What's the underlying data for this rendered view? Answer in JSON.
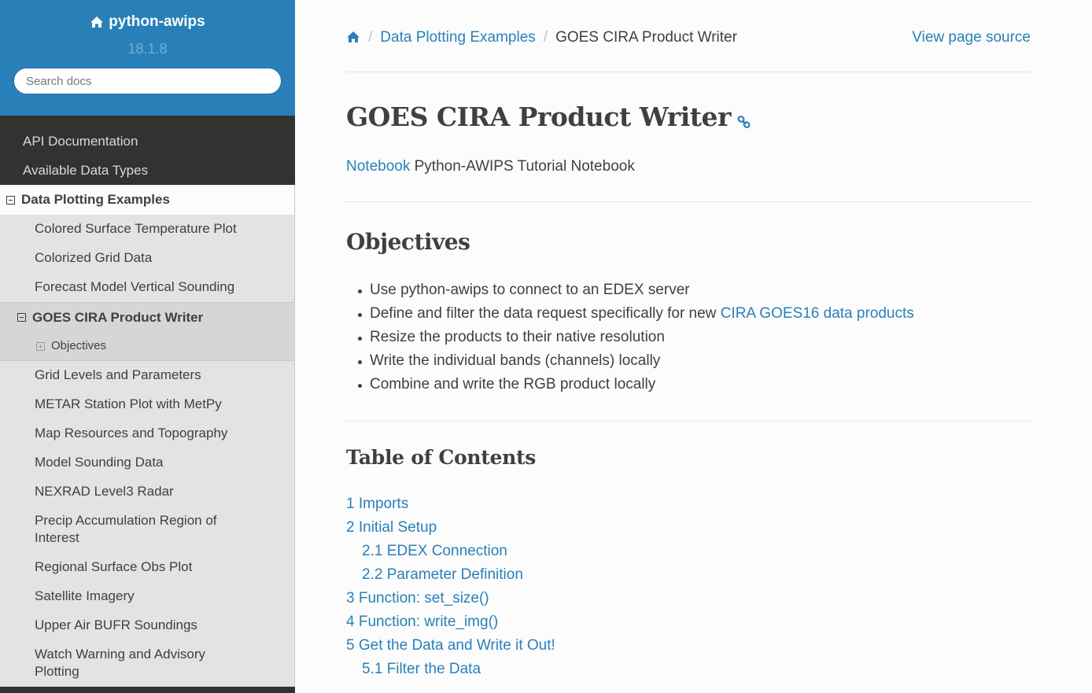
{
  "sidebar": {
    "project_name": "python-awips",
    "version": "18.1.8",
    "search_placeholder": "Search docs",
    "top_items": [
      {
        "label": "API Documentation"
      },
      {
        "label": "Available Data Types"
      }
    ],
    "current_section": "Data Plotting Examples",
    "sub_items_before": [
      {
        "label": "Colored Surface Temperature Plot"
      },
      {
        "label": "Colorized Grid Data"
      },
      {
        "label": "Forecast Model Vertical Sounding"
      }
    ],
    "current_page": "GOES CIRA Product Writer",
    "current_page_child": "Objectives",
    "sub_items_after": [
      {
        "label": "Grid Levels and Parameters"
      },
      {
        "label": "METAR Station Plot with MetPy"
      },
      {
        "label": "Map Resources and Topography"
      },
      {
        "label": "Model Sounding Data"
      },
      {
        "label": "NEXRAD Level3 Radar"
      },
      {
        "label": "Precip Accumulation Region of Interest"
      },
      {
        "label": "Regional Surface Obs Plot"
      },
      {
        "label": "Satellite Imagery"
      },
      {
        "label": "Upper Air BUFR Soundings"
      },
      {
        "label": "Watch Warning and Advisory Plotting"
      }
    ],
    "colors": {
      "header": "#2980b9",
      "dark": "#343131",
      "submenu": "#e3e3e3"
    }
  },
  "breadcrumbs": {
    "parent": "Data Plotting Examples",
    "current": "GOES CIRA Product Writer",
    "view_source": "View page source"
  },
  "content": {
    "title": "GOES CIRA Product Writer",
    "notebook_link": "Notebook",
    "notebook_text": " Python-AWIPS Tutorial Notebook",
    "objectives_title": "Objectives",
    "objectives": [
      {
        "text": "Use python-awips to connect to an EDEX server",
        "link": ""
      },
      {
        "text": "Define and filter the data request specifically for new ",
        "link": "CIRA GOES16 data products"
      },
      {
        "text": "Resize the products to their native resolution",
        "link": ""
      },
      {
        "text": "Write the individual bands (channels) locally",
        "link": ""
      },
      {
        "text": "Combine and write the RGB product locally",
        "link": ""
      }
    ],
    "toc_title": "Table of Contents",
    "toc": [
      {
        "label": "1 Imports",
        "level": 1
      },
      {
        "label": "2 Initial Setup",
        "level": 1
      },
      {
        "label": "2.1 EDEX Connection",
        "level": 2
      },
      {
        "label": "2.2 Parameter Definition",
        "level": 2
      },
      {
        "label": "3 Function: set_size()",
        "level": 1
      },
      {
        "label": "4 Function: write_img()",
        "level": 1
      },
      {
        "label": "5 Get the Data and Write it Out!",
        "level": 1
      },
      {
        "label": "5.1 Filter the Data",
        "level": 2
      }
    ],
    "colors": {
      "link": "#2980b9",
      "text": "#404040"
    }
  },
  "icons": {
    "home": "home-icon",
    "permalink": "link-icon"
  }
}
